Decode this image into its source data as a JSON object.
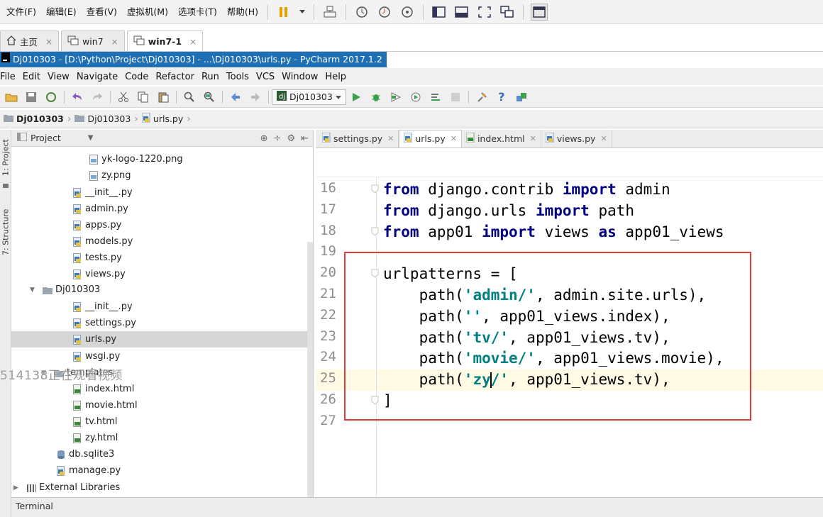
{
  "vm": {
    "menu": [
      "文件(F)",
      "编辑(E)",
      "查看(V)",
      "虚拟机(M)",
      "选项卡(T)",
      "帮助(H)"
    ],
    "tabs": [
      {
        "label": "主页",
        "active": false
      },
      {
        "label": "win7",
        "active": false
      },
      {
        "label": "win7-1",
        "active": true
      }
    ],
    "tab_close": "×"
  },
  "pycharm": {
    "title": "Dj010303 - [D:\\Python\\Project\\Dj010303] - ...\\Dj010303\\urls.py - PyCharm 2017.1.2",
    "menu": [
      "File",
      "Edit",
      "View",
      "Navigate",
      "Code",
      "Refactor",
      "Run",
      "Tools",
      "VCS",
      "Window",
      "Help"
    ],
    "run_config": "Dj010303",
    "breadcrumb": [
      "Dj010303",
      "Dj010303",
      "urls.py"
    ]
  },
  "stripe": {
    "project": "1: Project",
    "structure": "7: Structure"
  },
  "project_panel": {
    "header": "Project",
    "tree": [
      {
        "label": "yk-logo-1220.png",
        "icon": "image-file-icon"
      },
      {
        "label": "zy.png",
        "icon": "image-file-icon"
      },
      {
        "label": "__init__.py",
        "icon": "python-file-icon"
      },
      {
        "label": "admin.py",
        "icon": "python-file-icon"
      },
      {
        "label": "apps.py",
        "icon": "python-file-icon"
      },
      {
        "label": "models.py",
        "icon": "python-file-icon"
      },
      {
        "label": "tests.py",
        "icon": "python-file-icon"
      },
      {
        "label": "views.py",
        "icon": "python-file-icon"
      },
      {
        "label": "Dj010303",
        "icon": "folder-icon",
        "expanded": true
      },
      {
        "label": "__init__.py",
        "icon": "python-file-icon"
      },
      {
        "label": "settings.py",
        "icon": "python-file-icon"
      },
      {
        "label": "urls.py",
        "icon": "python-file-icon",
        "selected": true
      },
      {
        "label": "wsgi.py",
        "icon": "python-file-icon"
      },
      {
        "label": "templates",
        "icon": "folder-icon",
        "expanded": true
      },
      {
        "label": "index.html",
        "icon": "html-file-icon"
      },
      {
        "label": "movie.html",
        "icon": "html-file-icon"
      },
      {
        "label": "tv.html",
        "icon": "html-file-icon"
      },
      {
        "label": "zy.html",
        "icon": "html-file-icon"
      },
      {
        "label": "db.sqlite3",
        "icon": "database-icon"
      },
      {
        "label": "manage.py",
        "icon": "python-file-icon"
      },
      {
        "label": "External Libraries",
        "icon": "library-icon",
        "expanded": false
      }
    ]
  },
  "editor": {
    "tabs": [
      {
        "label": "settings.py",
        "active": false
      },
      {
        "label": "urls.py",
        "active": true
      },
      {
        "label": "index.html",
        "active": false
      },
      {
        "label": "views.py",
        "active": false
      }
    ],
    "line_numbers": [
      "16",
      "17",
      "18",
      "19",
      "20",
      "21",
      "22",
      "23",
      "24",
      "25",
      "26",
      "27"
    ],
    "lines": [
      [
        {
          "t": "from",
          "c": "kw"
        },
        {
          "t": " django.contrib "
        },
        {
          "t": "import",
          "c": "kw"
        },
        {
          "t": " admin"
        }
      ],
      [
        {
          "t": "from",
          "c": "kw"
        },
        {
          "t": " django.urls "
        },
        {
          "t": "import",
          "c": "kw"
        },
        {
          "t": " path"
        }
      ],
      [
        {
          "t": "from",
          "c": "kw"
        },
        {
          "t": " app01 "
        },
        {
          "t": "import",
          "c": "kw"
        },
        {
          "t": " views "
        },
        {
          "t": "as",
          "c": "kw"
        },
        {
          "t": " app01_views"
        }
      ],
      [],
      [
        {
          "t": "urlpatterns = ["
        }
      ],
      [
        {
          "t": "    path("
        },
        {
          "t": "'admin/'",
          "c": "str"
        },
        {
          "t": ", admin.site.urls),"
        }
      ],
      [
        {
          "t": "    path("
        },
        {
          "t": "''",
          "c": "str"
        },
        {
          "t": ", app01_views.index),"
        }
      ],
      [
        {
          "t": "    path("
        },
        {
          "t": "'tv/'",
          "c": "str"
        },
        {
          "t": ", app01_views.tv),"
        }
      ],
      [
        {
          "t": "    path("
        },
        {
          "t": "'movie/'",
          "c": "str"
        },
        {
          "t": ", app01_views.movie),"
        }
      ],
      [
        {
          "t": "    path("
        },
        {
          "t": "'zy",
          "c": "str"
        },
        {
          "t": "|",
          "c": "caret"
        },
        {
          "t": "/'",
          "c": "str"
        },
        {
          "t": ", app01_views.tv),"
        }
      ],
      [
        {
          "t": "]"
        }
      ],
      []
    ]
  },
  "bottom": {
    "terminal": "Terminal"
  },
  "watermark": "514138正在观看视频",
  "colors": {
    "title_bar": "#1f6fb5",
    "keyword": "#000080",
    "string": "#008080",
    "highlight_box": "#e03a3a",
    "current_line": "#fffae3"
  }
}
